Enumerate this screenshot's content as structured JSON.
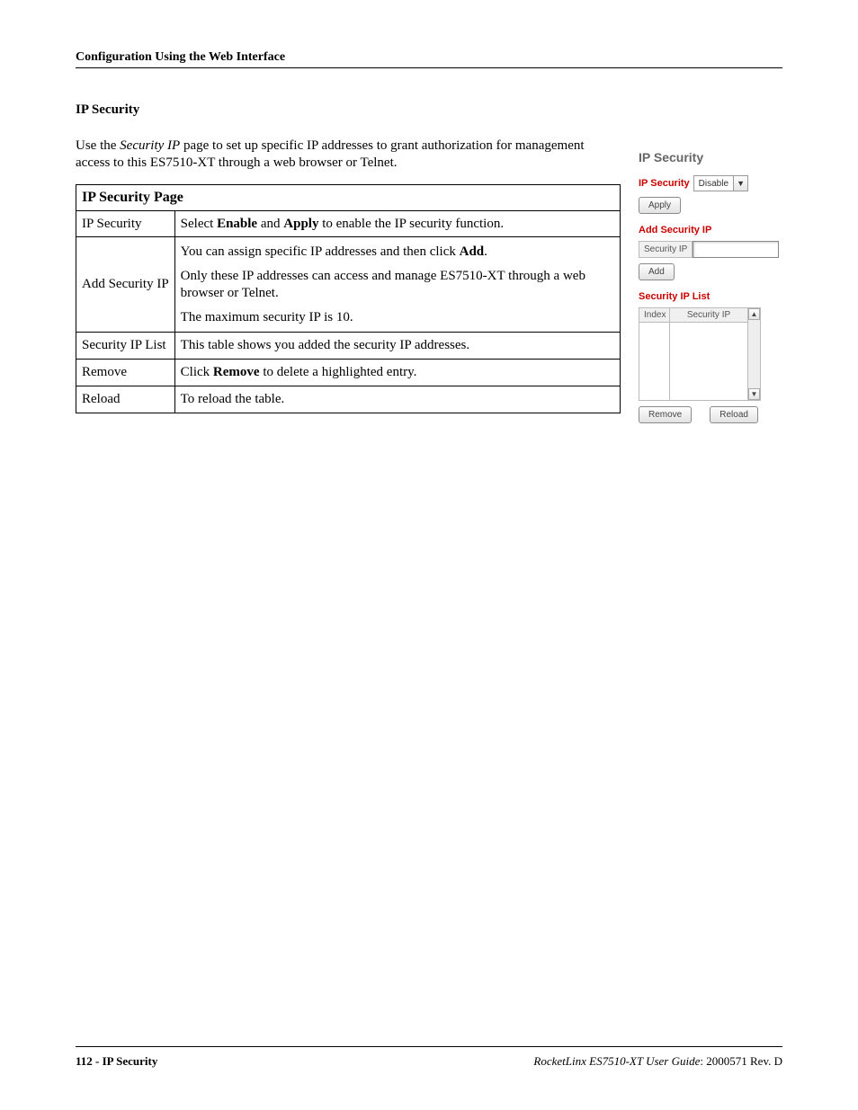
{
  "header": "Configuration Using the Web Interface",
  "section_heading": "IP Security",
  "intro": {
    "pre": "Use the ",
    "italic": "Security IP",
    "post": " page to set up specific IP addresses to grant authorization for management access to this ES7510-XT through a web browser or Telnet."
  },
  "table": {
    "title": "IP Security Page",
    "rows": {
      "r1": {
        "label": "IP Security",
        "d": {
          "pre": "Select ",
          "b1": "Enable",
          "mid": " and ",
          "b2": "Apply",
          "post": " to enable the IP security function."
        }
      },
      "r2": {
        "label": "Add Security IP",
        "d1": {
          "pre": "You can assign specific IP addresses and then click ",
          "b": "Add",
          "post": "."
        },
        "d2": "Only these IP addresses can access and manage ES7510-XT through a web browser or Telnet.",
        "d3": "The maximum security IP is 10."
      },
      "r3": {
        "label": "Security IP List",
        "d": "This table shows you added the security IP addresses."
      },
      "r4": {
        "label": "Remove",
        "d": {
          "pre": "Click ",
          "b": "Remove",
          "post": " to delete a highlighted entry."
        }
      },
      "r5": {
        "label": "Reload",
        "d": "To reload the table."
      }
    }
  },
  "panel": {
    "title": "IP Security",
    "sec1": {
      "heading": "IP Security",
      "select_value": "Disable",
      "apply": "Apply"
    },
    "sec2": {
      "heading": "Add Security IP",
      "field_label": "Security IP",
      "add": "Add"
    },
    "sec3": {
      "heading": "Security IP List",
      "col1": "Index",
      "col2": "Security IP",
      "remove": "Remove",
      "reload": "Reload"
    }
  },
  "footer": {
    "left_page": "112 - IP Security",
    "right_italic": "RocketLinx ES7510-XT  User Guide",
    "right_rest": ": 2000571 Rev. D"
  }
}
